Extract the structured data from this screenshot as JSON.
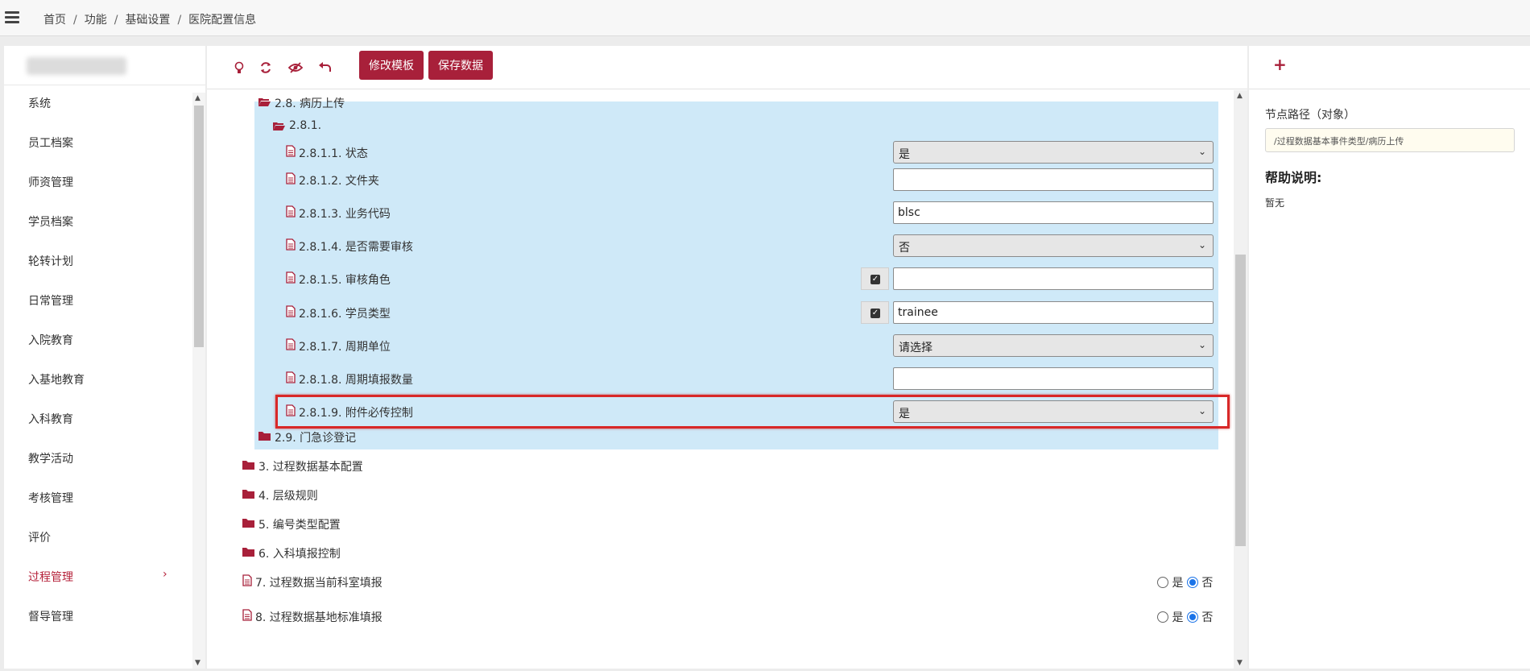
{
  "breadcrumb": [
    "首页",
    "功能",
    "基础设置",
    "医院配置信息"
  ],
  "sidebar": {
    "items": [
      {
        "label": "系统"
      },
      {
        "label": "员工档案"
      },
      {
        "label": "师资管理"
      },
      {
        "label": "学员档案"
      },
      {
        "label": "轮转计划"
      },
      {
        "label": "日常管理"
      },
      {
        "label": "入院教育"
      },
      {
        "label": "入基地教育"
      },
      {
        "label": "入科教育"
      },
      {
        "label": "教学活动"
      },
      {
        "label": "考核管理"
      },
      {
        "label": "评价"
      },
      {
        "label": "过程管理",
        "active": true,
        "arrow": "›"
      },
      {
        "label": "督导管理"
      }
    ]
  },
  "toolbar": {
    "icons": [
      "lightbulb-icon",
      "refresh-icon",
      "eye-slash-icon",
      "undo-icon"
    ],
    "edit_template_label": "修改模板",
    "save_data_label": "保存数据"
  },
  "tree": {
    "node_2_8": "2.8. 病历上传",
    "node_2_8_1": "2.8.1.",
    "items": [
      {
        "label": "2.8.1.1. 状态",
        "type": "select",
        "value": "是"
      },
      {
        "label": "2.8.1.2. 文件夹",
        "type": "input",
        "value": ""
      },
      {
        "label": "2.8.1.3. 业务代码",
        "type": "input",
        "value": "blsc"
      },
      {
        "label": "2.8.1.4. 是否需要审核",
        "type": "select",
        "value": "否"
      },
      {
        "label": "2.8.1.5. 审核角色",
        "type": "input",
        "value": "",
        "checkbox": true
      },
      {
        "label": "2.8.1.6. 学员类型",
        "type": "input",
        "value": "trainee",
        "checkbox": true
      },
      {
        "label": "2.8.1.7. 周期单位",
        "type": "select",
        "value": "请选择"
      },
      {
        "label": "2.8.1.8. 周期填报数量",
        "type": "input",
        "value": ""
      },
      {
        "label": "2.8.1.9. 附件必传控制",
        "type": "select",
        "value": "是"
      }
    ],
    "node_2_9": "2.9. 门急诊登记",
    "folders": [
      "3. 过程数据基本配置",
      "4. 层级规则",
      "5. 编号类型配置",
      "6. 入科填报控制"
    ],
    "radio_items": [
      {
        "label": "7. 过程数据当前科室填报",
        "yes": "是",
        "no": "否",
        "selected": "否"
      },
      {
        "label": "8. 过程数据基地标准填报",
        "yes": "是",
        "no": "否",
        "selected": "否"
      }
    ]
  },
  "right_panel": {
    "path_label": "节点路径（对象）",
    "path_value": "/过程数据基本事件类型/病历上传",
    "help_title": "帮助说明:",
    "help_text": "暂无"
  },
  "colors": {
    "accent": "#a8203a",
    "highlight": "#cfe9f8",
    "annotation_frame": "#d82828",
    "radio_selected": "#1a73e8"
  }
}
